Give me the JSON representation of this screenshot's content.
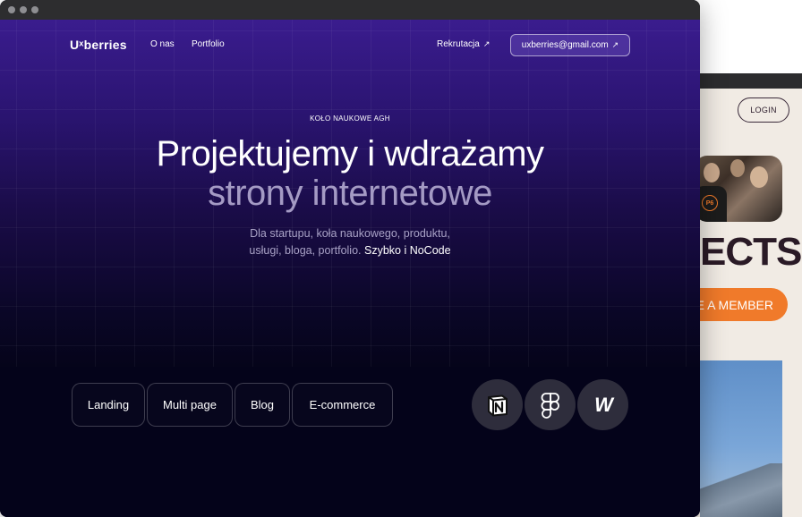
{
  "front": {
    "nav": {
      "logo": "Uˣberries",
      "links": [
        "O nas",
        "Portfolio"
      ],
      "rekrutacja": "Rekrutacja",
      "email": "uxberries@gmail.com",
      "arrow": "↗"
    },
    "hero": {
      "eyebrow": "KOŁO NAUKOWE AGH",
      "headline_line1": "Projektujemy i wdrażamy",
      "headline_line2": "strony internetowe",
      "sub_line1": "Dla startupu, koła naukowego, produktu,",
      "sub_line2": "usługi, bloga, portfolio. ",
      "sub_highlight": "Szybko i NoCode"
    },
    "services": [
      "Landing",
      "Multi page",
      "Blog",
      "E-commerce"
    ],
    "tools": [
      "notion-icon",
      "figma-icon",
      "webflow-icon"
    ],
    "tool_webflow_glyph": "W"
  },
  "back": {
    "login": "LOGIN",
    "photo_badge": "P6",
    "heading_fragment": "ECTS",
    "cta_fragment": "E A MEMBER"
  },
  "colors": {
    "hero_top": "#3a1c8e",
    "page_bg": "#04031a",
    "accent_orange": "#f07a2a",
    "back_bg": "#f1ebe4"
  }
}
